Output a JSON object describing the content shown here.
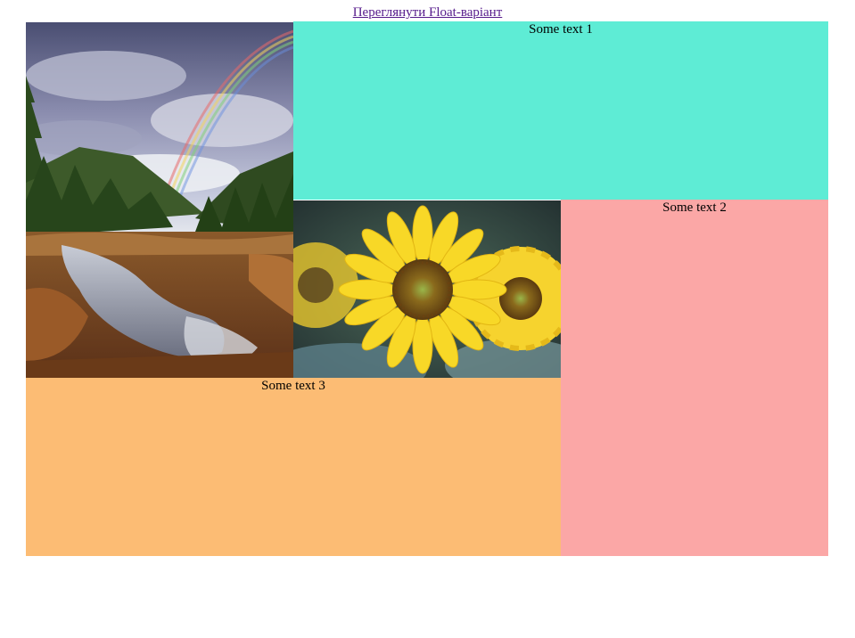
{
  "header": {
    "link_text": "Переглянути Float-варіант"
  },
  "blocks": {
    "text1": {
      "label": "Some text 1",
      "color": "#5eecd5"
    },
    "text2": {
      "label": "Some text 2",
      "color": "#fba7a6"
    },
    "text3": {
      "label": "Some text 3",
      "color": "#fcbc74"
    }
  },
  "images": {
    "landscape": {
      "icon": "landscape-rainbow-image"
    },
    "sunflower": {
      "icon": "sunflower-image"
    }
  }
}
